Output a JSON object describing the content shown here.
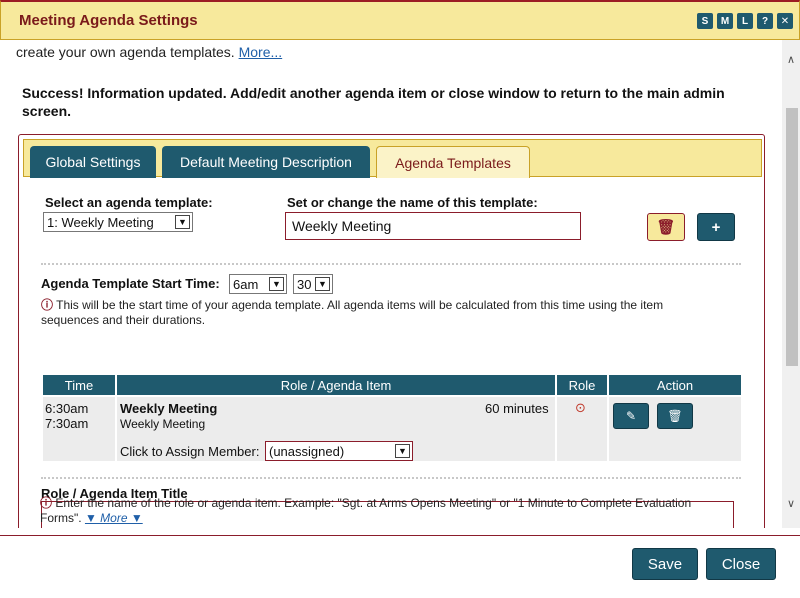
{
  "window": {
    "title": "Meeting Agenda Settings",
    "size_buttons": [
      "S",
      "M",
      "L",
      "?"
    ],
    "close_glyph": "✕"
  },
  "intro": {
    "text": "create your own agenda templates.",
    "more_link": "More..."
  },
  "success_message": "Success! Information updated. Add/edit another agenda item or close window to return to the main admin screen.",
  "tabs": [
    {
      "label": "Global Settings",
      "active": false
    },
    {
      "label": "Default Meeting Description",
      "active": false
    },
    {
      "label": "Agenda Templates",
      "active": true
    }
  ],
  "template": {
    "select_label": "Select an agenda template:",
    "select_value": "1: Weekly Meeting",
    "name_label": "Set or change the name of this template:",
    "name_value": "Weekly Meeting",
    "delete_icon": "trash-icon",
    "add_icon": "plus-icon"
  },
  "start_time": {
    "label": "Agenda Template Start Time:",
    "hour": "6am",
    "minute": "30",
    "info": "This will be the start time of your agenda template. All agenda items will be calculated from this time using the item sequences and their durations."
  },
  "table": {
    "headers": [
      "Time",
      "Role / Agenda Item",
      "Role",
      "Action"
    ],
    "rows": [
      {
        "start": "6:30am",
        "end": "7:30am",
        "title": "Weekly Meeting",
        "subtitle": "Weekly Meeting",
        "duration": "60 minutes",
        "assign_label": "Click to Assign Member:",
        "assign_value": "(unassigned)",
        "role_icon": "clock-icon",
        "edit_icon": "pencil-icon",
        "delete_icon": "trash-icon"
      }
    ]
  },
  "item_title": {
    "label": "Role / Agenda Item Title",
    "value": "",
    "info": "Enter the name of the role or agenda item. Example: \"Sgt. at Arms Opens Meeting\" or \"1 Minute to Complete Evaluation Forms\".",
    "more_link": "▼ More ▼"
  },
  "footer": {
    "save": "Save",
    "close": "Close"
  },
  "colors": {
    "accent": "#1f5a6e",
    "highlight": "#f7e99c",
    "border": "#8b1d2b"
  }
}
